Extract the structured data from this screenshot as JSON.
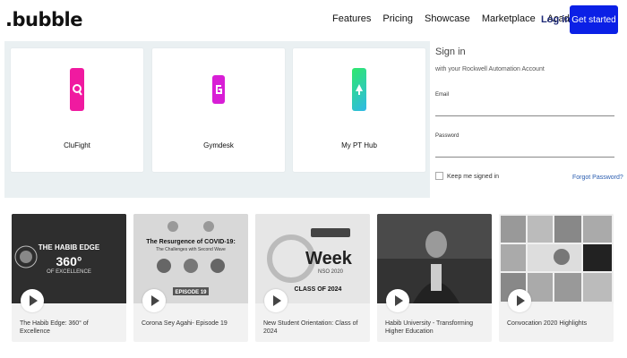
{
  "nav": {
    "logo": ".bubble",
    "links": [
      "Features",
      "Pricing",
      "Showcase",
      "Marketplace",
      "Academy"
    ],
    "login": "Log in",
    "cta": "Get started"
  },
  "apps": [
    {
      "name": "CluFight",
      "color": "#f01aa0",
      "icon": "clufight-icon"
    },
    {
      "name": "Gymdesk",
      "color": "#d81ed6",
      "icon": "gymdesk-icon"
    },
    {
      "name": "My PT Hub",
      "color": "#2fb8e8",
      "icon": "mypthub-icon"
    }
  ],
  "signin": {
    "title": "Sign in",
    "subtitle": "with your Rockwell Automation Account",
    "email_label": "Email",
    "password_label": "Password",
    "keep_signed": "Keep me signed in",
    "forgot": "Forgot Password?"
  },
  "videos": [
    {
      "title": "The Habib Edge: 360° of Excellence",
      "thumb_text1": "THE HABIB EDGE",
      "thumb_text2": "360°",
      "thumb_text3": "OF EXCELLENCE"
    },
    {
      "title": "Corona Sey Agahi- Episode 19",
      "thumb_text1": "The Resurgence of COVID-19:",
      "thumb_text2": "The Challenges with Second Wave",
      "thumb_text3": "EPISODE 19"
    },
    {
      "title": "New Student Orientation: Class of 2024",
      "thumb_text1": "Week",
      "thumb_text2": "NSO 2020",
      "thumb_text3": "CLASS OF 2024"
    },
    {
      "title": "Habib University - Transforming Higher Education",
      "thumb_text1": "",
      "thumb_text2": "",
      "thumb_text3": ""
    },
    {
      "title": "Convocation 2020 Highlights",
      "thumb_text1": "",
      "thumb_text2": "",
      "thumb_text3": ""
    }
  ]
}
